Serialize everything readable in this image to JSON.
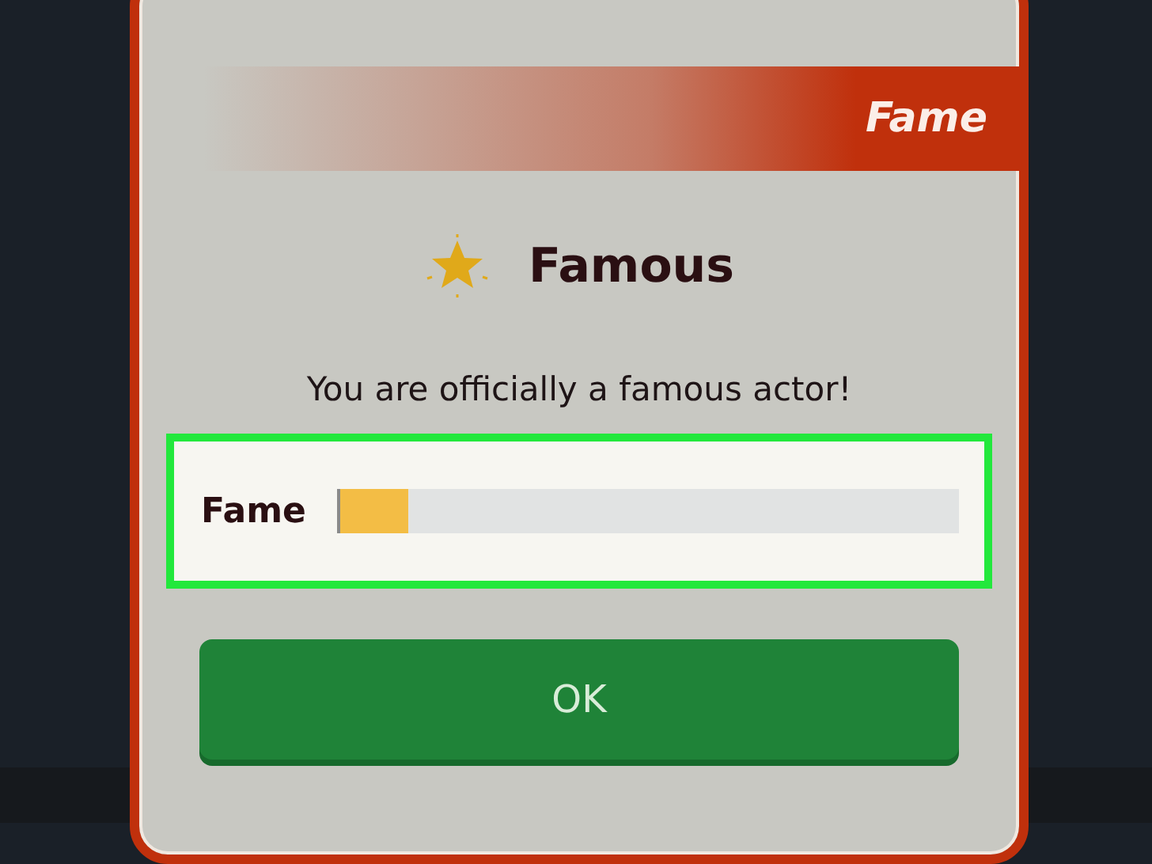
{
  "dialog": {
    "banner": "Fame",
    "title": "Famous",
    "message": "You are officially a famous actor!",
    "meter": {
      "label": "Fame",
      "level": 0.11
    },
    "button": "OK"
  }
}
